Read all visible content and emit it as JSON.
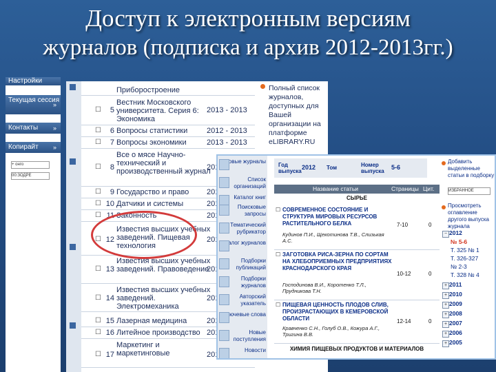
{
  "title": {
    "line1": "Доступ к электронным версиям",
    "line2a": "журналов",
    "line2b": "(подписка и архив 2012-2013гг.)"
  },
  "leftnav": {
    "items": [
      "Настройки",
      "Текущая сессия",
      "Контакты",
      "Копирайт"
    ],
    "arrows": [
      "»",
      "»",
      "»"
    ],
    "small_selects": [
      "+ онго",
      "00:ЗОДРЕ"
    ]
  },
  "journals": [
    {
      "num": "",
      "name": "Приборостроение",
      "years": ""
    },
    {
      "num": "5",
      "name": "Вестник Московского университета. Серия 6: Экономика",
      "years": "2013 - 2013"
    },
    {
      "num": "6",
      "name": "Вопросы статистики",
      "years": "2012 - 2013"
    },
    {
      "num": "7",
      "name": "Вопросы экономики",
      "years": "2013 - 2013"
    },
    {
      "num": "8",
      "name": "Все о мясе Научно-технический и производственный журнал",
      "years": "201"
    },
    {
      "num": "9",
      "name": "Государство и право",
      "years": "201"
    },
    {
      "num": "10",
      "name": "Датчики и системы",
      "years": "201"
    },
    {
      "num": "11",
      "name": "Законность",
      "years": "201"
    },
    {
      "num": "12",
      "name": "Известия высших учебных заведений. Пищевая технология",
      "years": "201"
    },
    {
      "num": "13",
      "name": "Известия высших учебных заведений. Правоведение",
      "years": "201"
    },
    {
      "num": "14",
      "name": "Известия высших учебных заведений. Электромеханика",
      "years": "201"
    },
    {
      "num": "15",
      "name": "Лазерная медицина",
      "years": "201"
    },
    {
      "num": "16",
      "name": "Литейное производство",
      "years": "201"
    },
    {
      "num": "17",
      "name": "Маркетинг и маркетинговые",
      "years": "201"
    }
  ],
  "infobox": "Полный список журналов, доступных для Вашей организации на платформе eLIBRARY.RU",
  "overlay": {
    "menu": [
      "Новые журналы",
      "Список организаций",
      "Каталог книг",
      "Поисковые запросы",
      "Тематический рубрикатор",
      "Каталог журналов",
      "Подборки публикаций",
      "Подборки журналов",
      "Авторский указатель",
      "Ключевые слова",
      "Новые поступления",
      "Новости"
    ],
    "issue_bar": {
      "year_label": "Год выпуска",
      "year": "2012",
      "vol_label": "Том",
      "num_label": "Номер выпуска",
      "num": "5-6"
    },
    "table_headers": {
      "name": "Название статьи",
      "pages": "Страницы",
      "cit": "Цит."
    },
    "section1": "СЫРЬЕ",
    "articles": [
      {
        "title": "СОВРЕМЕННОЕ СОСТОЯНИЕ И СТРУКТУРА МИРОВЫХ РЕСУРСОВ РАСТИТЕЛЬНОГО БЕЛКА",
        "authors": "Кудинов П.И., Щекотинова Т.В., Слизькая А.С.",
        "pages": "7-10",
        "cit": "0"
      },
      {
        "title": "ЗАГОТОВКА РИСА-ЗЕРНА ПО СОРТАМ НА ХЛЕБОПРИЕМНЫХ ПРЕДПРИЯТИЯХ КРАСНОДАРСКОГО КРАЯ",
        "authors": "Господинова В.И., Коротенко Т.Л., Прудникова Т.Н.",
        "pages": "10-12",
        "cit": "0"
      },
      {
        "title": "ПИЩЕВАЯ ЦЕННОСТЬ ПЛОДОВ СЛИВ, ПРОИЗРАСТАЮЩИХ В КЕМЕРОВСКОЙ ОБЛАСТИ",
        "authors": "Кравченко С.Н., Голуб О.В., Кожура А.Г., Тригина В.В.",
        "pages": "12-14",
        "cit": "0"
      }
    ],
    "section2": "ХИМИЯ ПИЩЕВЫХ ПРОДУКТОВ И МАТЕРИАЛОВ",
    "right": {
      "add_text": "Добавить выделенные статьи в подборку:",
      "select": "ИЗБРАННОЕ",
      "browse_text": "Просмотреть оглавление другого выпуска журнала",
      "years": [
        "2012",
        "2011",
        "2010",
        "2009",
        "2008",
        "2007",
        "2006",
        "2005"
      ],
      "issues_2012": [
        "№ 5-6",
        "Т. 325 № 1",
        "Т. 326-327",
        "№ 2-3",
        "Т. 328 № 4"
      ]
    }
  },
  "colors": {
    "accent": "#e46a1e",
    "link": "#0b2e87",
    "highlight_circle": "#d33b3b"
  }
}
